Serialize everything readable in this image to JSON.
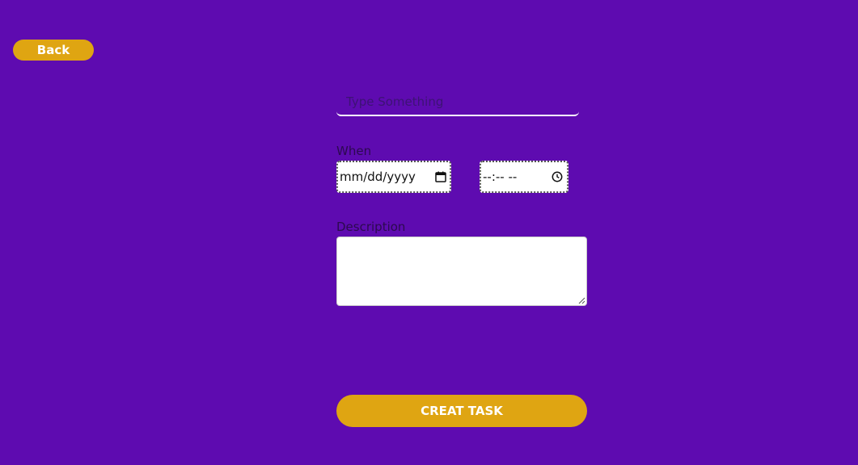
{
  "header": {
    "back_label": "Back"
  },
  "form": {
    "title_placeholder": "Type Something",
    "when_label": "When",
    "date_placeholder": "mm/dd/yyyy",
    "time_placeholder": "--:-- --",
    "description_label": "Description",
    "description_value": "",
    "submit_label": "CREAT TASK"
  },
  "icons": {
    "date": "calendar-icon",
    "time": "clock-icon",
    "textarea_resize": "resize-handle-icon"
  },
  "colors": {
    "background": "#5e0bb0",
    "accent": "#dfa512",
    "button_text": "#ffffff"
  }
}
